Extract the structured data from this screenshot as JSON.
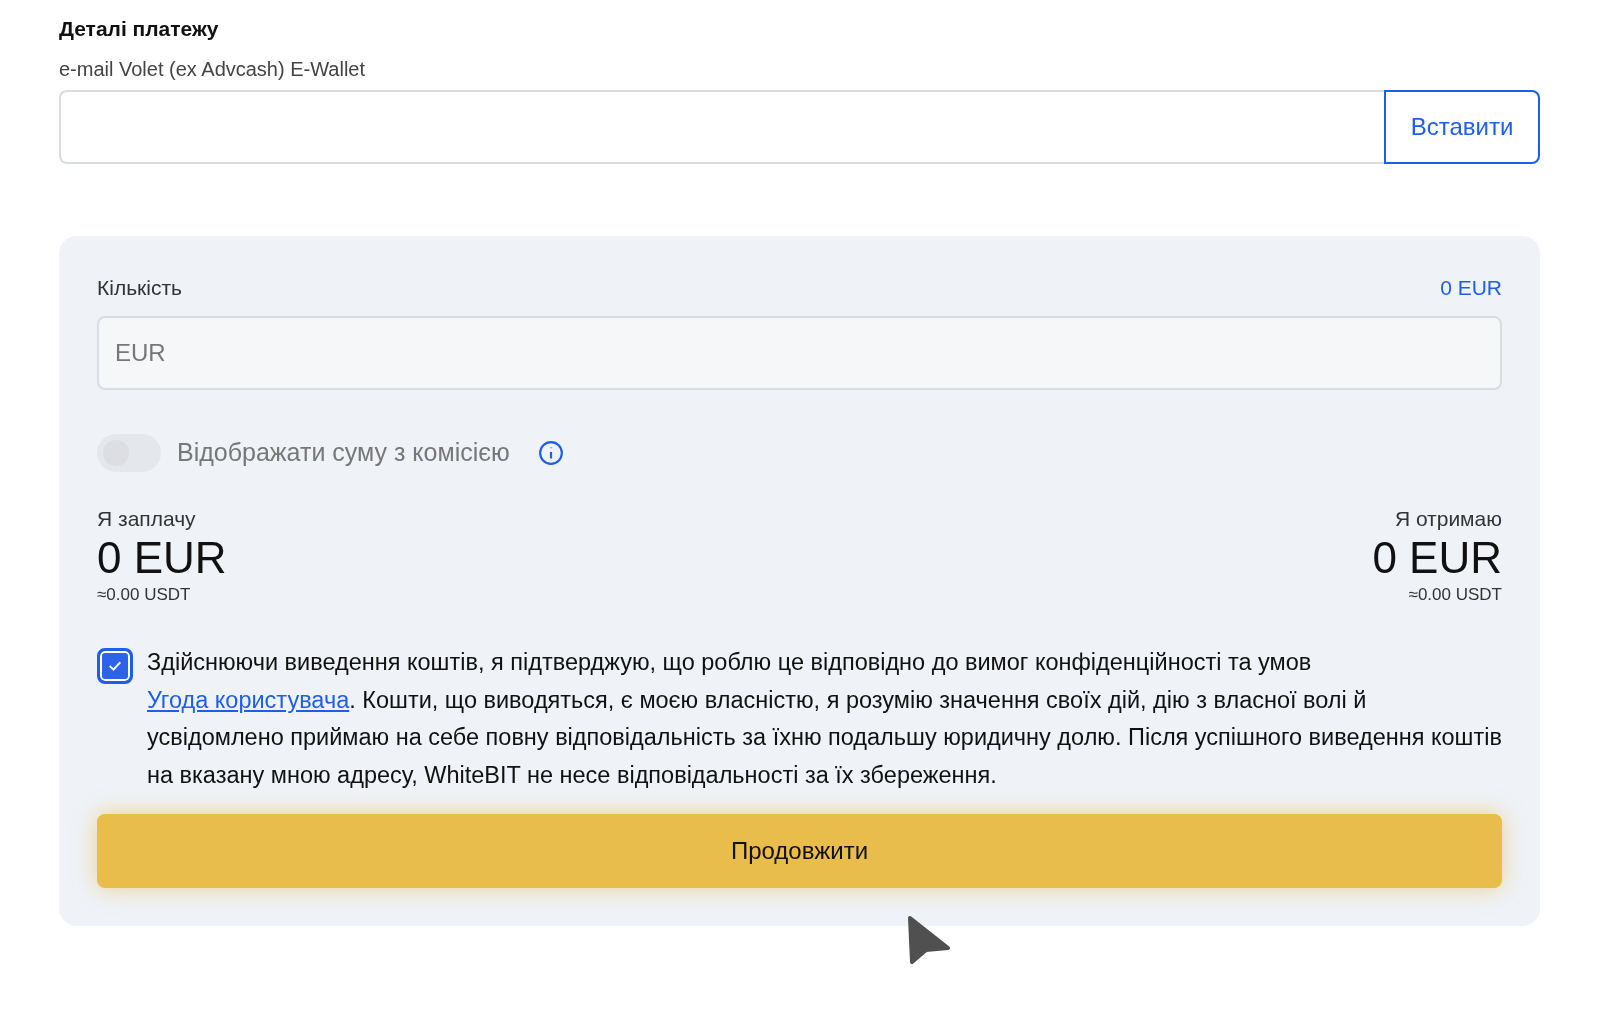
{
  "section_title": "Деталі платежу",
  "wallet_field": {
    "label": "e-mail Volet (ex Advcash) E-Wallet",
    "paste_button": "Вставити"
  },
  "amount": {
    "label": "Кількість",
    "balance": "0 EUR",
    "placeholder": "EUR"
  },
  "fee_toggle": {
    "label": "Відображати суму з комісією",
    "on": false,
    "disabled": true
  },
  "summary": [
    {
      "label": "Я заплачу",
      "amount": "0 EUR",
      "approx": "≈0.00 USDT"
    },
    {
      "label": "Я отримаю",
      "amount": "0 EUR",
      "approx": "≈0.00 USDT"
    }
  ],
  "consent": {
    "checked": true,
    "text_before": "Здійснюючи виведення коштів, я підтверджую, що роблю це відповідно до вимог конфіденційності та умов ",
    "link": "Угода користувача",
    "text_after": ". Кошти, що виводяться, є моєю власністю, я розумію значення своїх дій, дію з власної волі й усвідомлено приймаю на себе повну відповідальність за їхню подальшу юридичну долю. Після успішного виведення коштів на вказану мною адресу, WhiteBIT не несе відповідальності за їх збереження."
  },
  "continue_button": "Продовжити"
}
